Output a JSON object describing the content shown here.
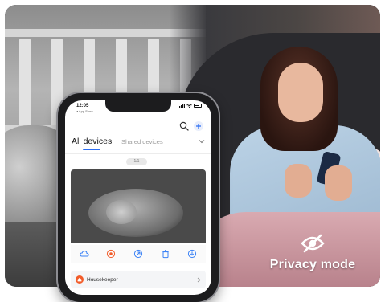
{
  "badge": {
    "icon": "eye-off-icon",
    "label": "Privacy mode"
  },
  "phone": {
    "status": {
      "time": "12:05",
      "back_label": "◂ App Store"
    },
    "tabs": [
      {
        "label": "All devices",
        "active": true
      },
      {
        "label": "Shared devices",
        "active": false
      }
    ],
    "day_pill": "1/1",
    "controls": [
      {
        "icon": "cloud-icon"
      },
      {
        "icon": "record-icon"
      },
      {
        "icon": "share-icon"
      },
      {
        "icon": "trash-icon"
      },
      {
        "icon": "download-icon"
      }
    ],
    "device": {
      "icon": "home-icon",
      "name": "Housekeeper"
    }
  },
  "colors": {
    "accent": "#2a6df4",
    "device_icon": "#f25c2a",
    "control_icon": "#3b82f6",
    "record_icon": "#f25c2a"
  }
}
